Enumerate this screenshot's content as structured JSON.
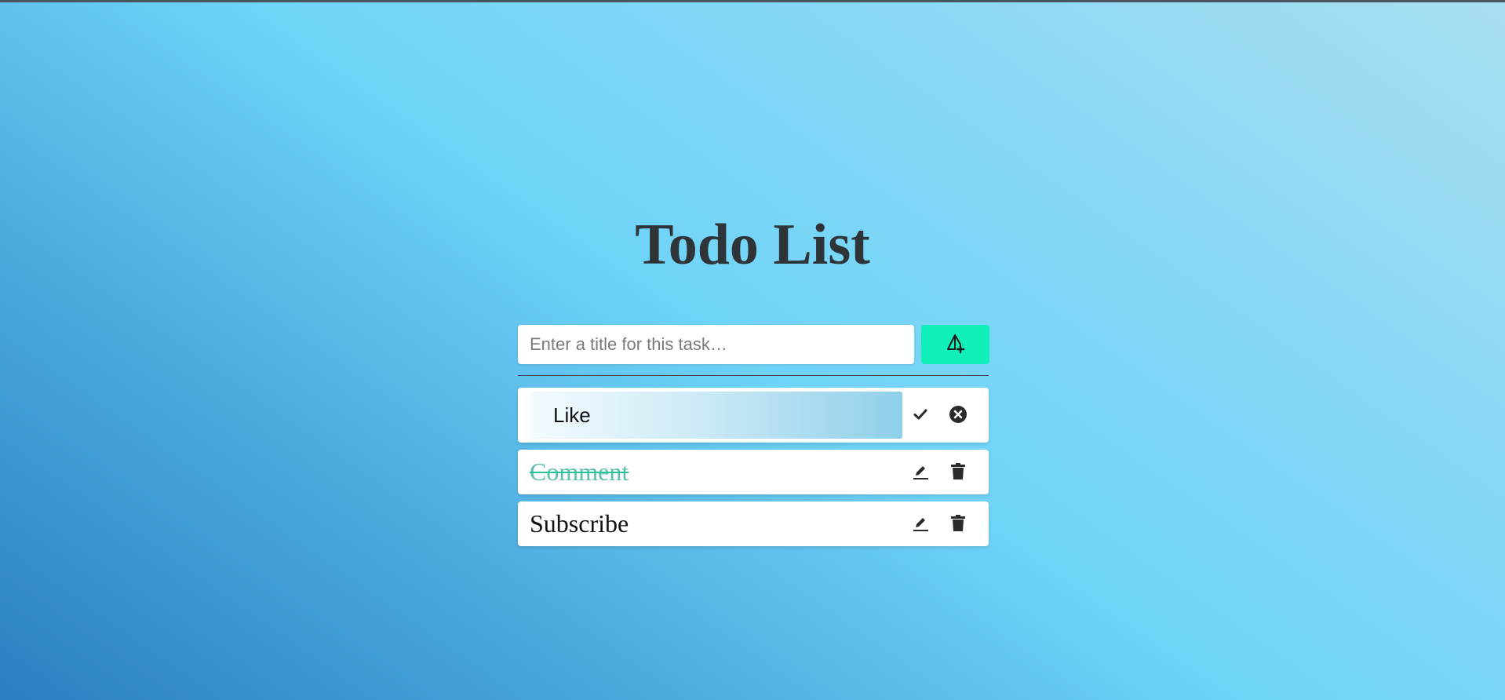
{
  "app": {
    "title": "Todo List"
  },
  "new_task": {
    "placeholder": "Enter a title for this task…",
    "value": "",
    "add_button_icon": "add-task-icon"
  },
  "colors": {
    "accent": "#10f0b8",
    "title": "#2f3438",
    "completed_text": "#5cbfae"
  },
  "todos": [
    {
      "title": "Like",
      "state": "editing",
      "actions": [
        "check-icon",
        "cancel-icon"
      ]
    },
    {
      "title": "Comment",
      "state": "completed",
      "actions": [
        "pencil-icon",
        "trash-icon"
      ]
    },
    {
      "title": "Subscribe",
      "state": "active",
      "actions": [
        "pencil-icon",
        "trash-icon"
      ]
    }
  ]
}
